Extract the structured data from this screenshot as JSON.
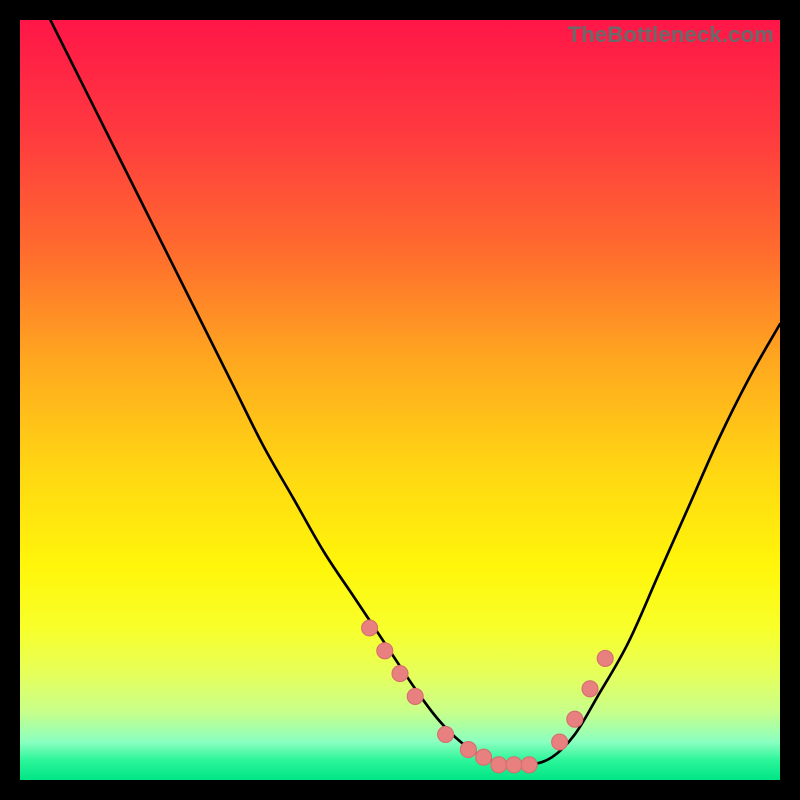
{
  "watermark": "TheBottleneck.com",
  "colors": {
    "background": "#000000",
    "gradient_stops": [
      {
        "offset": 0.0,
        "color": "#ff1648"
      },
      {
        "offset": 0.15,
        "color": "#ff3a3f"
      },
      {
        "offset": 0.3,
        "color": "#ff6a2e"
      },
      {
        "offset": 0.45,
        "color": "#ffa81f"
      },
      {
        "offset": 0.6,
        "color": "#ffd912"
      },
      {
        "offset": 0.72,
        "color": "#fff60a"
      },
      {
        "offset": 0.8,
        "color": "#f8ff2a"
      },
      {
        "offset": 0.86,
        "color": "#e6ff5a"
      },
      {
        "offset": 0.91,
        "color": "#c8ff8a"
      },
      {
        "offset": 0.95,
        "color": "#8affc0"
      },
      {
        "offset": 0.975,
        "color": "#29f598"
      },
      {
        "offset": 1.0,
        "color": "#00e586"
      }
    ],
    "curve": "#000000",
    "marker_fill": "#e98080",
    "marker_stroke": "#d76e6e"
  },
  "chart_data": {
    "type": "line",
    "title": "",
    "xlabel": "",
    "ylabel": "",
    "xlim": [
      0,
      100
    ],
    "ylim": [
      0,
      100
    ],
    "grid": false,
    "series": [
      {
        "name": "bottleneck-curve",
        "x": [
          0,
          4,
          8,
          12,
          16,
          20,
          24,
          28,
          32,
          36,
          40,
          44,
          48,
          52,
          55,
          58,
          61,
          64,
          67,
          70,
          73,
          76,
          80,
          84,
          88,
          92,
          96,
          100
        ],
        "y": [
          108,
          100,
          92,
          84,
          76,
          68,
          60,
          52,
          44,
          37,
          30,
          24,
          18,
          12,
          8,
          5,
          3,
          2,
          2,
          3,
          6,
          11,
          18,
          27,
          36,
          45,
          53,
          60
        ]
      }
    ],
    "markers": {
      "name": "highlight-points",
      "x": [
        46,
        48,
        50,
        52,
        56,
        59,
        61,
        63,
        65,
        67,
        71,
        73,
        75,
        77
      ],
      "y": [
        20,
        17,
        14,
        11,
        6,
        4,
        3,
        2,
        2,
        2,
        5,
        8,
        12,
        16
      ]
    }
  }
}
